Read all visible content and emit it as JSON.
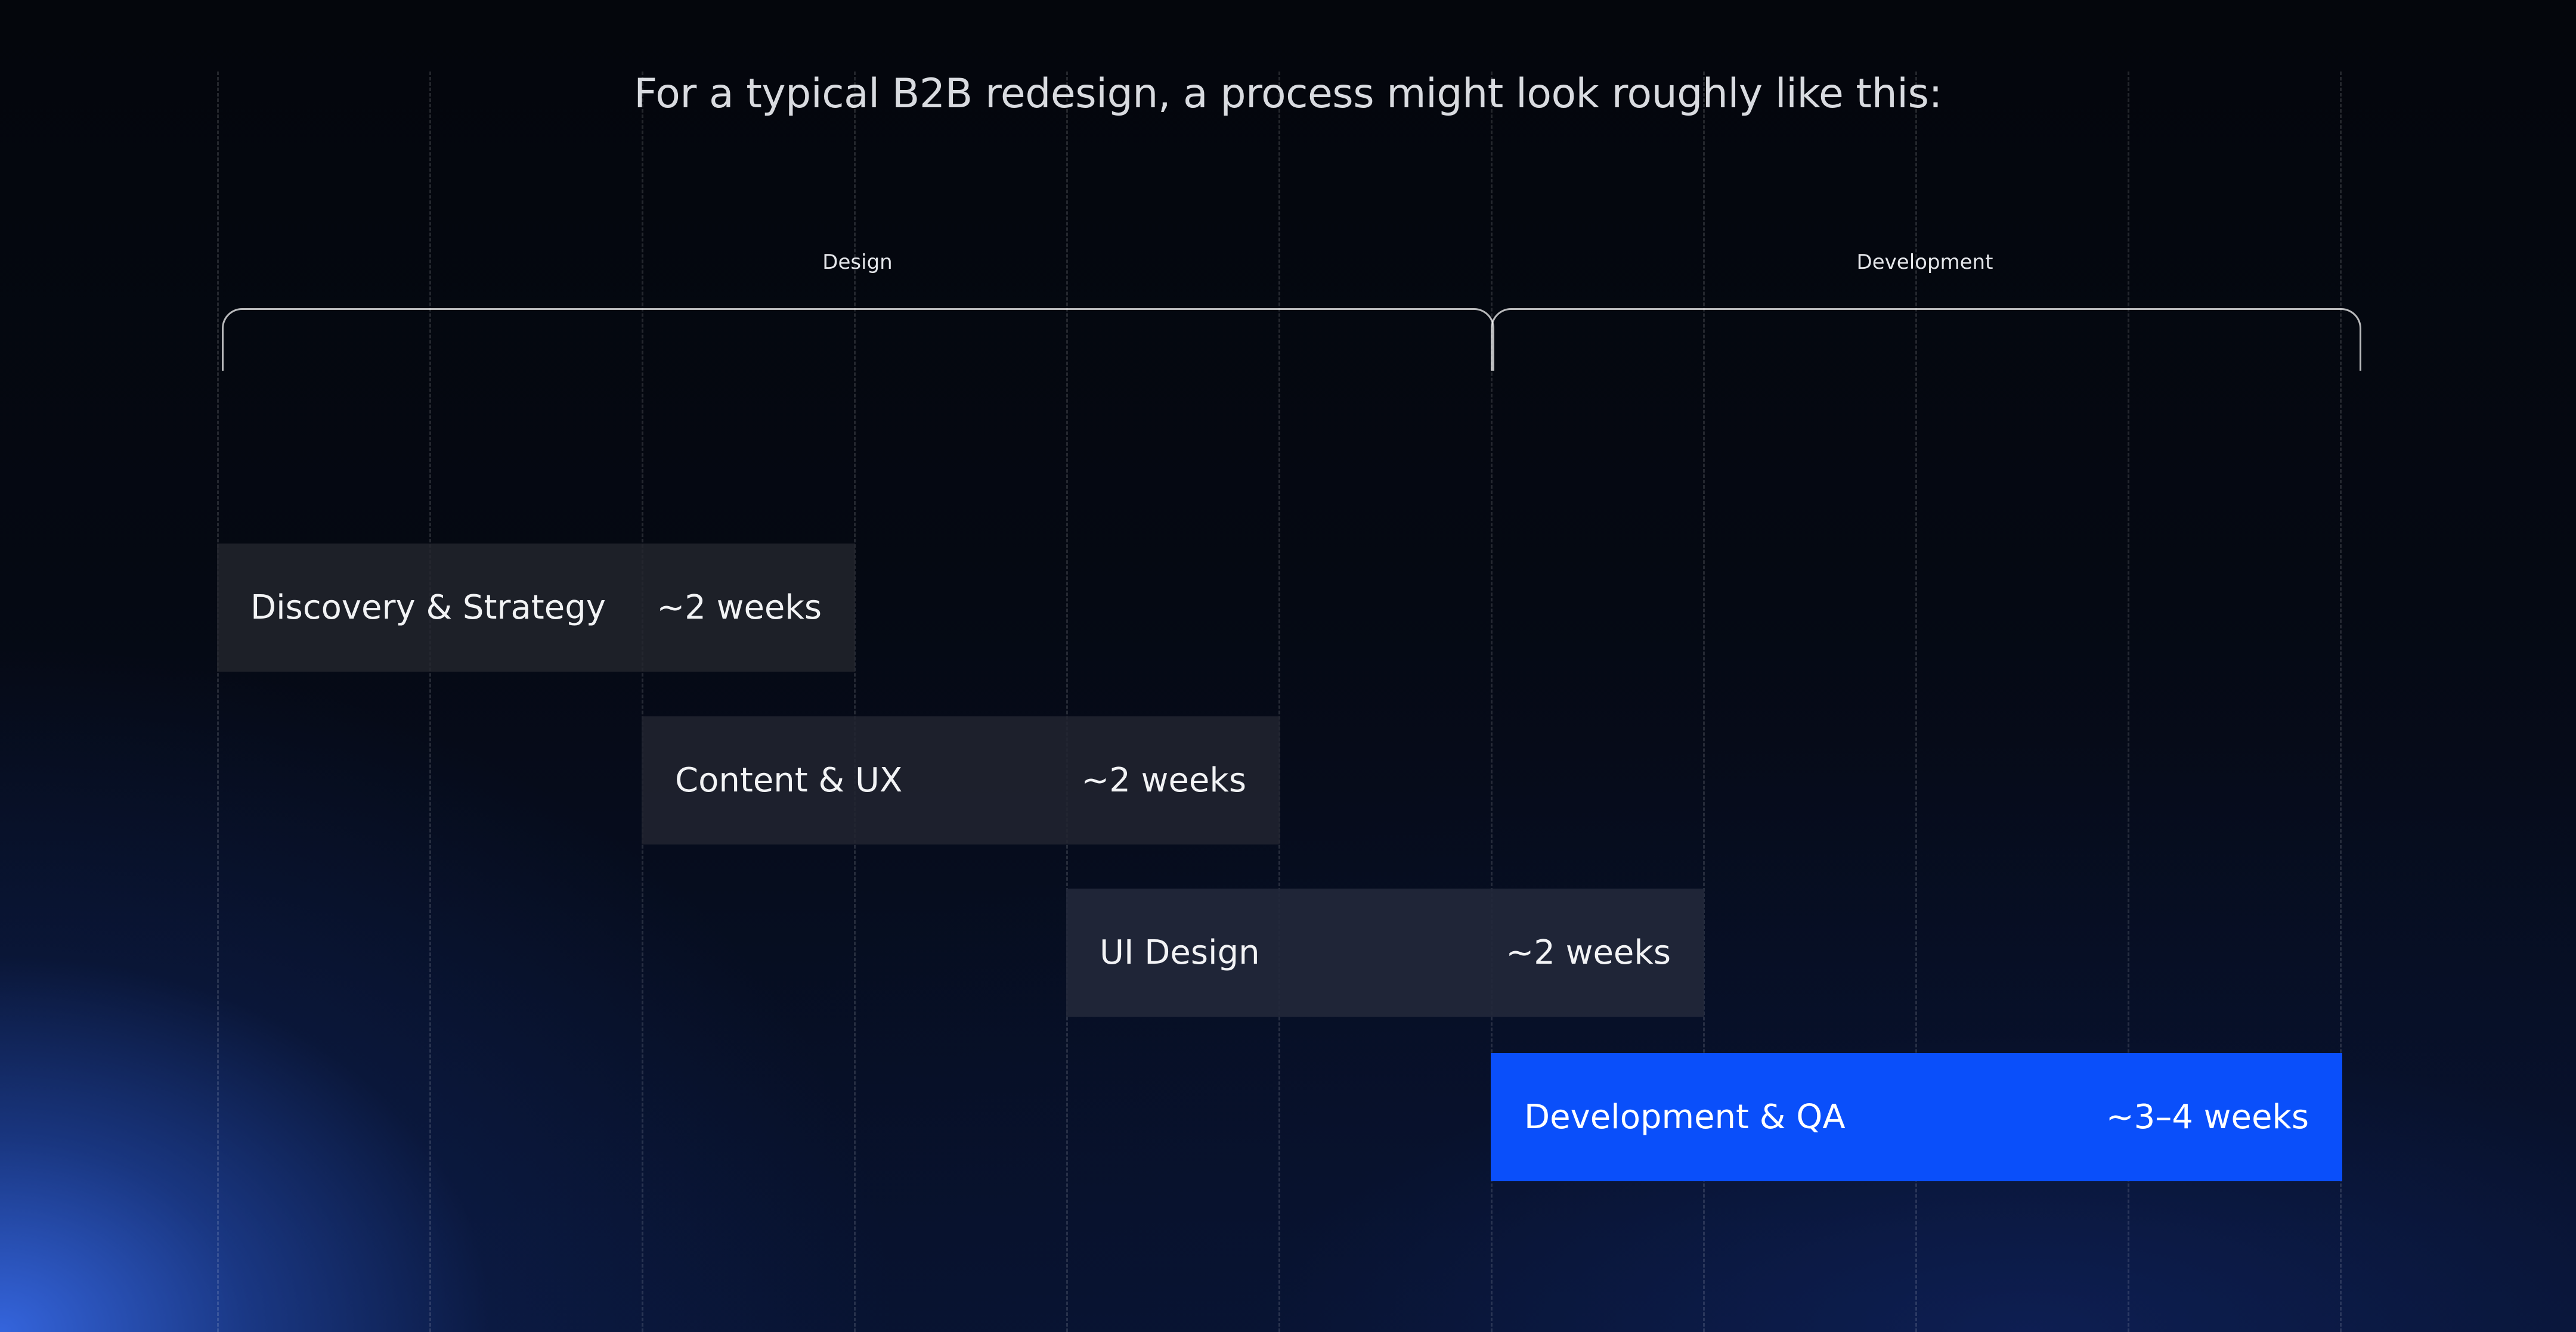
{
  "headline": "For a typical B2B redesign, a process might look roughly like this:",
  "phases": [
    {
      "label": "Design"
    },
    {
      "label": "Development"
    }
  ],
  "timeline": [
    {
      "name": "Discovery & Strategy",
      "duration": "~2 weeks"
    },
    {
      "name": "Content & UX",
      "duration": "~2 weeks"
    },
    {
      "name": "UI Design",
      "duration": "~2 weeks"
    },
    {
      "name": "Development & QA",
      "duration": "~3–4 weeks"
    }
  ],
  "colors": {
    "background": "#04060c",
    "accent_blue": "#0a4ffa",
    "bar_dark": "#24262e",
    "text": "#ffffff"
  }
}
